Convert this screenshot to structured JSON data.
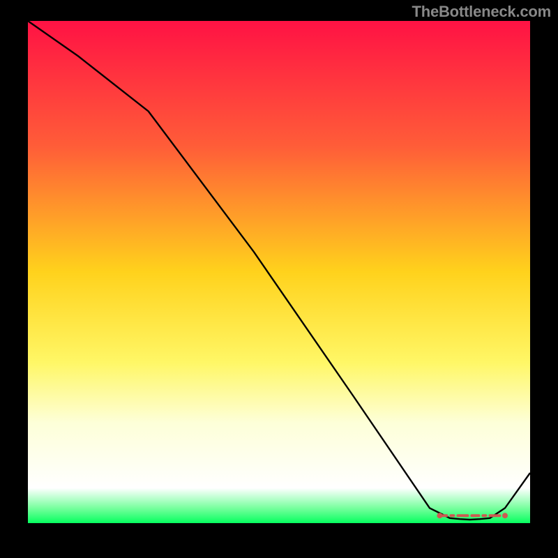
{
  "watermark": "TheBottleneck.com",
  "chart_data": {
    "type": "line",
    "title": "",
    "xlabel": "",
    "ylabel": "",
    "xlim": [
      0,
      100
    ],
    "ylim": [
      0,
      100
    ],
    "grid": false,
    "legend": false,
    "x": [
      0,
      10,
      24,
      45,
      65,
      80,
      84,
      86,
      88,
      90,
      92,
      95,
      100
    ],
    "values": [
      100,
      93,
      82,
      54,
      25,
      3,
      1,
      0.8,
      0.7,
      0.8,
      1,
      3,
      10
    ],
    "optimum_band": {
      "x_start": 82,
      "x_end": 95,
      "y": 1.5
    },
    "optimum_band_color": "#cc5a52",
    "gradient_stops": [
      {
        "offset": 0.0,
        "color": "#ff1244"
      },
      {
        "offset": 0.25,
        "color": "#ff5d38"
      },
      {
        "offset": 0.5,
        "color": "#ffd21c"
      },
      {
        "offset": 0.68,
        "color": "#fff766"
      },
      {
        "offset": 0.8,
        "color": "#fdffd8"
      },
      {
        "offset": 0.93,
        "color": "#ffffff"
      },
      {
        "offset": 0.97,
        "color": "#78ff9e"
      },
      {
        "offset": 1.0,
        "color": "#06ff5f"
      }
    ],
    "line_color": "#000000",
    "background": "#000000"
  }
}
